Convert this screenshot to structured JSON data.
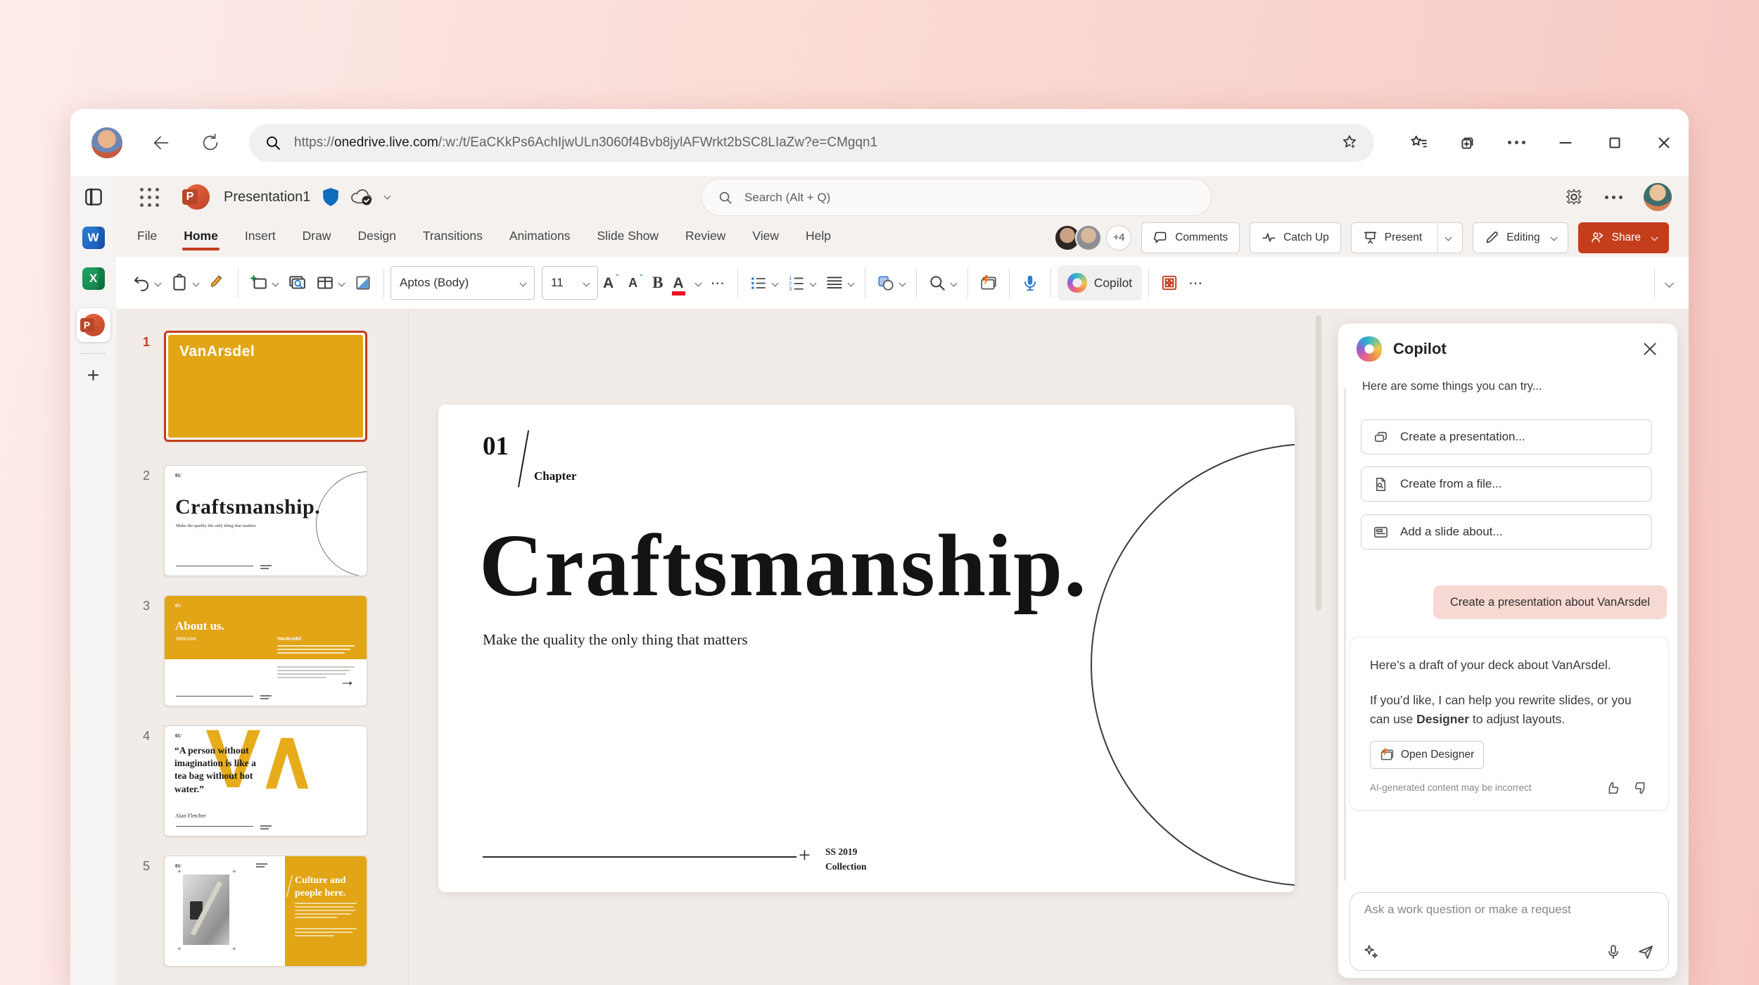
{
  "browser": {
    "url_scheme": "https://",
    "url_host": "onedrive.live.com",
    "url_path": "/:w:/t/EaCKkPs6AchIjwULn3060f4Bvb8jylAFWrkt2bSC8LIaZw?e=CMgqn1"
  },
  "app_bar": {
    "title": "Presentation1",
    "search_placeholder": "Search (Alt + Q)"
  },
  "ribbon": {
    "tabs": [
      "File",
      "Home",
      "Insert",
      "Draw",
      "Design",
      "Transitions",
      "Animations",
      "Slide Show",
      "Review",
      "View",
      "Help"
    ],
    "active_tab": "Home",
    "presence_overflow": "+4",
    "comments": "Comments",
    "catch_up": "Catch Up",
    "present": "Present",
    "editing": "Editing",
    "share": "Share"
  },
  "toolbar": {
    "font_name": "Aptos (Body)",
    "font_size": "11",
    "bold_glyph": "B",
    "grow_glyph": "A",
    "shrink_glyph": "A",
    "font_color_glyph": "A",
    "copilot": "Copilot"
  },
  "chapter_mark": {
    "no": "01",
    "label": "Chapter"
  },
  "slides": [
    {
      "n": "1",
      "logo": "VanArsdel"
    },
    {
      "n": "2",
      "chapter_no": "01",
      "chapter_label": "Chapter",
      "title": "Craftsmanship.",
      "subtitle": "Make the quality the only thing that matters",
      "footer_top": "SS 2019",
      "footer_bottom": "Collection"
    },
    {
      "n": "3",
      "title": "About us.",
      "welcome": "Welcome",
      "sidebar_heading": "VanArsdel"
    },
    {
      "n": "4",
      "quote": "“A person without imagination is like a tea bag without hot water.”",
      "attribution": "Alan Fletcher"
    },
    {
      "n": "5",
      "title": "Culture and people here."
    }
  ],
  "copilot": {
    "title": "Copilot",
    "intro": "Here are some things you can try...",
    "suggestions": [
      {
        "label": "Create a presentation..."
      },
      {
        "label": "Create from a file..."
      },
      {
        "label": "Add a slide about..."
      }
    ],
    "user_prompt": "Create a presentation about VanArsdel",
    "response_p1": "Here’s a draft of your deck about VanArsdel.",
    "response_p2_before": "If you’d like, I can help you rewrite slides, or you can use ",
    "response_p2_bold": "Designer",
    "response_p2_after": " to adjust layouts.",
    "open_designer": "Open Designer",
    "disclaimer": "AI-generated content may be incorrect",
    "input_placeholder": "Ask a work question or make a request"
  },
  "glyphs": {
    "ellipsis": "⋯",
    "arrow": "→",
    "plus": "+"
  }
}
